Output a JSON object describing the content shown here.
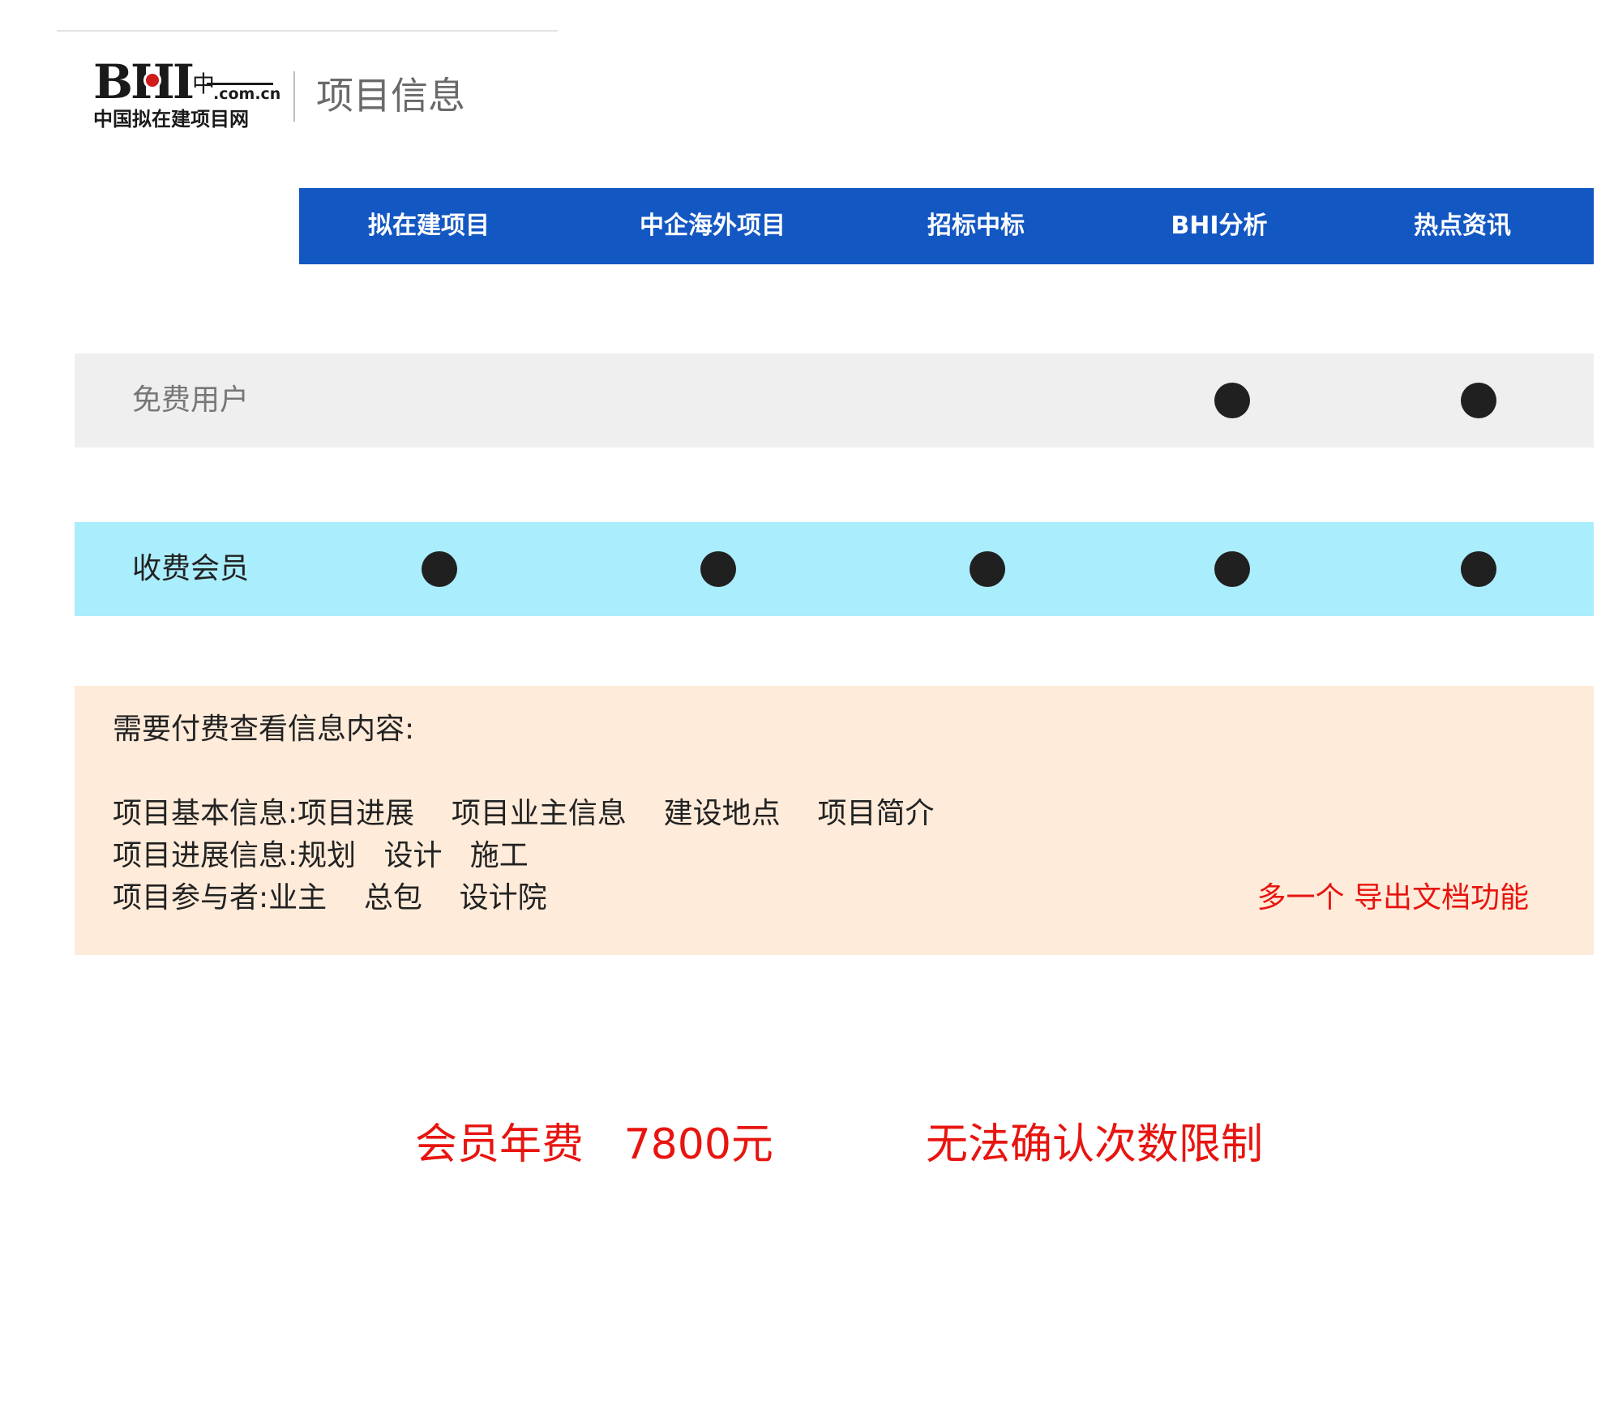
{
  "header": {
    "logo": {
      "mark": "BHI",
      "cn_glyph": "中",
      "domain": ".com.cn",
      "tagline": "中国拟在建项目网"
    },
    "title": "项目信息"
  },
  "nav": {
    "items": [
      {
        "label": "拟在建项目"
      },
      {
        "label": "中企海外项目"
      },
      {
        "label": "招标中标"
      },
      {
        "label": "BHI分析"
      },
      {
        "label": "热点资讯"
      }
    ]
  },
  "tiers": [
    {
      "label": "免费用户",
      "access": [
        false,
        false,
        false,
        true,
        true
      ]
    },
    {
      "label": "收费会员",
      "access": [
        true,
        true,
        true,
        true,
        true
      ]
    }
  ],
  "paid_info": {
    "heading": "需要付费查看信息内容:",
    "lines": [
      "项目基本信息:项目进展    项目业主信息    建设地点    项目简介",
      "项目进展信息:规划   设计   施工",
      "项目参与者:业主    总包    设计院"
    ],
    "note": "多一个 导出文档功能"
  },
  "footer": {
    "fee": "会员年费   7800元",
    "limit": "无法确认次数限制"
  },
  "colors": {
    "nav_bg": "#1357c2",
    "free_row_bg": "#efefef",
    "paid_row_bg": "#aaedfd",
    "info_bg": "#ffebda",
    "highlight_red": "#e8140f",
    "dot": "#202020"
  }
}
